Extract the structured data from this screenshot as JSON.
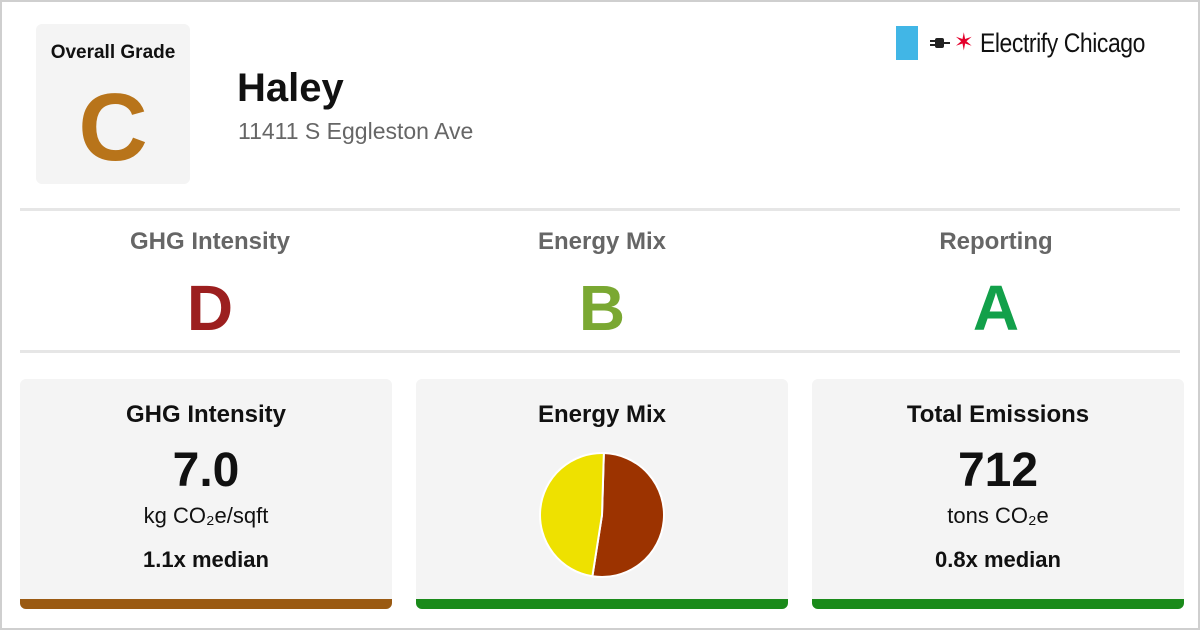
{
  "overall": {
    "label": "Overall Grade",
    "grade": "C",
    "color": "#b8741a"
  },
  "building": {
    "name": "Haley",
    "address": "11411 S Eggleston Ave"
  },
  "logo": {
    "text": "Electrify Chicago",
    "icon": "plug-icon",
    "star_icon": "red-star-icon",
    "flag_color": "#41b6e6",
    "star_color": "#e4002b"
  },
  "sub_grades": [
    {
      "title": "GHG Intensity",
      "grade": "D",
      "color": "#9c1f1f"
    },
    {
      "title": "Energy Mix",
      "grade": "B",
      "color": "#7aa832"
    },
    {
      "title": "Reporting",
      "grade": "A",
      "color": "#12a04a"
    }
  ],
  "cards": [
    {
      "title": "GHG Intensity",
      "value": "7.0",
      "unit": "kg CO₂e/sqft",
      "median": "1.1x median",
      "bar_color": "#9a5a12"
    },
    {
      "title": "Energy Mix",
      "bar_color": "#1a8a1a"
    },
    {
      "title": "Total Emissions",
      "value": "712",
      "unit": "tons CO₂e",
      "median": "0.8x median",
      "bar_color": "#1a8a1a"
    }
  ],
  "chart_data": {
    "type": "pie",
    "slices": [
      {
        "fraction": 0.52,
        "color": "#9c3300"
      },
      {
        "fraction": 0.48,
        "color": "#eee100"
      }
    ]
  }
}
